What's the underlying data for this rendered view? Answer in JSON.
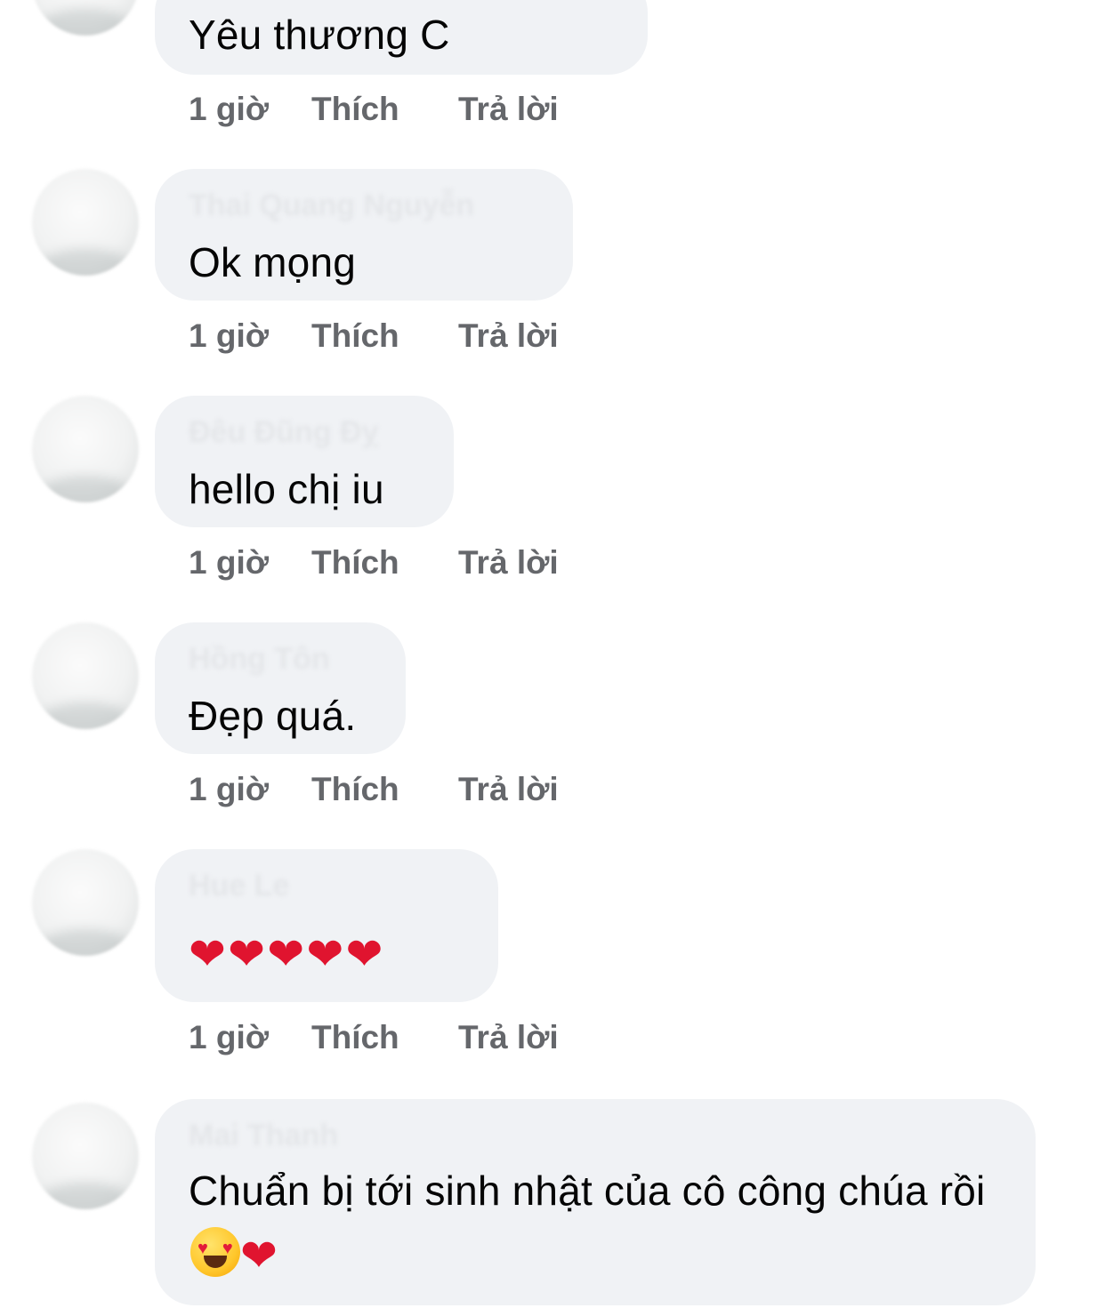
{
  "comments": [
    {
      "author": "",
      "text": "Yêu thương C",
      "time": "1 giờ",
      "like": "Thích",
      "reply": "Trả lời"
    },
    {
      "author": "Thai Quang Nguyễn",
      "text": "Ok mọng",
      "time": "1 giờ",
      "like": "Thích",
      "reply": "Trả lời"
    },
    {
      "author": "Đêu Đũng Đỵ",
      "text": "hello chị iu",
      "time": "1 giờ",
      "like": "Thích",
      "reply": "Trả lời"
    },
    {
      "author": "Hồng Tôn",
      "text": "Đẹp quá.",
      "time": "1 giờ",
      "like": "Thích",
      "reply": "Trả lời"
    },
    {
      "author": "Hue Le",
      "text": "❤❤❤❤❤",
      "time": "1 giờ",
      "like": "Thích",
      "reply": "Trả lời"
    },
    {
      "author": "Mai Thanh",
      "text": "Chuẩn bị tới sinh nhật của cô công chúa rồi",
      "emoji_tail": "😍❤",
      "time": "",
      "like": "",
      "reply": ""
    }
  ],
  "icons": {
    "heart_color": "#e0142f",
    "bubble_color": "#f0f2f5",
    "action_color": "#65676b"
  }
}
